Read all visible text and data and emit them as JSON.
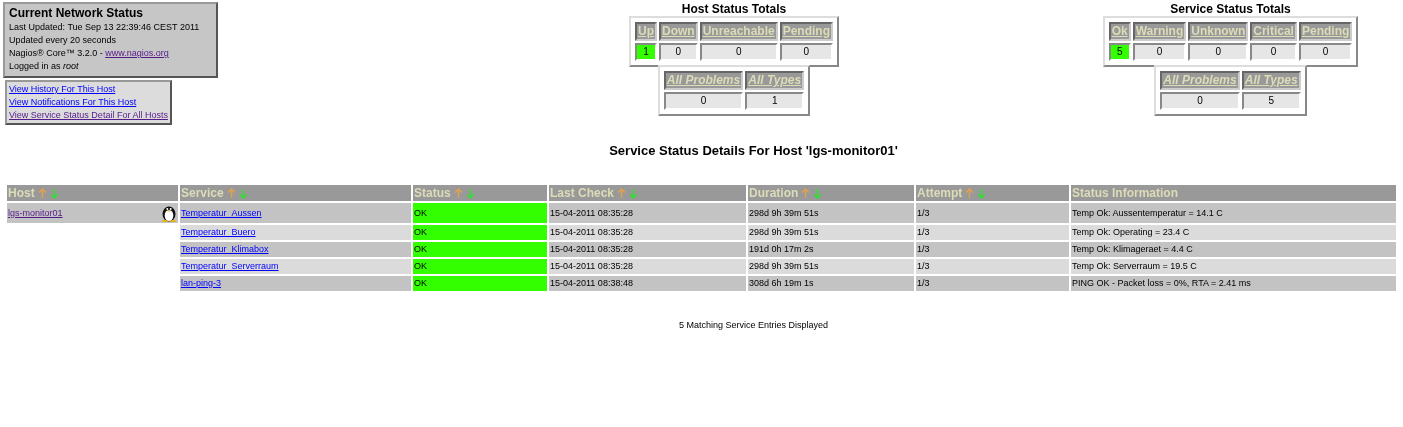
{
  "info_box": {
    "title": "Current Network Status",
    "lines": [
      {
        "kind": "text",
        "text": "Last Updated: Tue Sep 13 22:39:46 CEST 2011"
      },
      {
        "kind": "text",
        "text": "Updated every 20 seconds"
      },
      {
        "kind": "link",
        "text": "Nagios® Core™ 3.2.0 - ",
        "link": "www.nagios.org",
        "visited": true
      },
      {
        "kind": "text",
        "text": "Logged in as *root*"
      }
    ]
  },
  "links": [
    {
      "label": "View History For This Host",
      "visited": false
    },
    {
      "label": "View Notifications For This Host",
      "visited": false
    },
    {
      "label": "View Service Status Detail For All Hosts",
      "visited": true
    }
  ],
  "host_totals": {
    "title": "Host Status Totals",
    "columns": [
      {
        "label": "Up",
        "value": "1",
        "highlight": true
      },
      {
        "label": "Down",
        "value": "0",
        "highlight": false
      },
      {
        "label": "Unreachable",
        "value": "0",
        "highlight": false
      },
      {
        "label": "Pending",
        "value": "0",
        "highlight": false
      }
    ],
    "summary": [
      {
        "label": "All Problems",
        "value": "0"
      },
      {
        "label": "All Types",
        "value": "1"
      }
    ]
  },
  "service_totals": {
    "title": "Service Status Totals",
    "columns": [
      {
        "label": "Ok",
        "value": "5",
        "highlight": true
      },
      {
        "label": "Warning",
        "value": "0",
        "highlight": false
      },
      {
        "label": "Unknown",
        "value": "0",
        "highlight": false
      },
      {
        "label": "Critical",
        "value": "0",
        "highlight": false
      },
      {
        "label": "Pending",
        "value": "0",
        "highlight": false
      }
    ],
    "summary": [
      {
        "label": "All Problems",
        "value": "0"
      },
      {
        "label": "All Types",
        "value": "5"
      }
    ]
  },
  "heading": "Service Status Details For Host 'lgs-monitor01'",
  "table": {
    "columns": [
      {
        "label": "Host",
        "sortable": true
      },
      {
        "label": "Service",
        "sortable": true
      },
      {
        "label": "Status",
        "sortable": true
      },
      {
        "label": "Last Check",
        "sortable": true
      },
      {
        "label": "Duration",
        "sortable": true
      },
      {
        "label": "Attempt",
        "sortable": true
      },
      {
        "label": "Status Information",
        "sortable": false
      }
    ],
    "rows": [
      {
        "host": "lgs-monitor01",
        "host_visited": true,
        "service": "Temperatur_Aussen",
        "status": "OK",
        "color": "#33ff00",
        "last_check": "15-04-2011 08:35:28",
        "duration": "298d 9h 39m 51s",
        "attempt": "1/3",
        "info": "Temp Ok: Aussentemperatur = 14.1 C"
      },
      {
        "service": "Temperatur_Buero",
        "status": "OK",
        "color": "#33ff00",
        "last_check": "15-04-2011 08:35:28",
        "duration": "298d 9h 39m 51s",
        "attempt": "1/3",
        "info": "Temp Ok: Operating = 23.4 C"
      },
      {
        "service": "Temperatur_Klimabox",
        "status": "OK",
        "color": "#33ff00",
        "last_check": "15-04-2011 08:35:28",
        "duration": "191d 0h 17m 2s",
        "attempt": "1/3",
        "info": "Temp Ok: Klimageraet = 4.4 C"
      },
      {
        "service": "Temperatur_Serverraum",
        "status": "OK",
        "color": "#33ff00",
        "last_check": "15-04-2011 08:35:28",
        "duration": "298d 9h 39m 51s",
        "attempt": "1/3",
        "info": "Temp Ok: Serverraum = 19.5 C"
      },
      {
        "service": "lan-ping-3",
        "status": "OK",
        "color": "#33ff00",
        "last_check": "15-04-2011 08:38:48",
        "duration": "308d 6h 19m 1s",
        "attempt": "1/3",
        "info": "PING OK - Packet loss = 0%, RTA = 2.41 ms"
      }
    ]
  },
  "footer": "5 Matching Service Entries Displayed"
}
